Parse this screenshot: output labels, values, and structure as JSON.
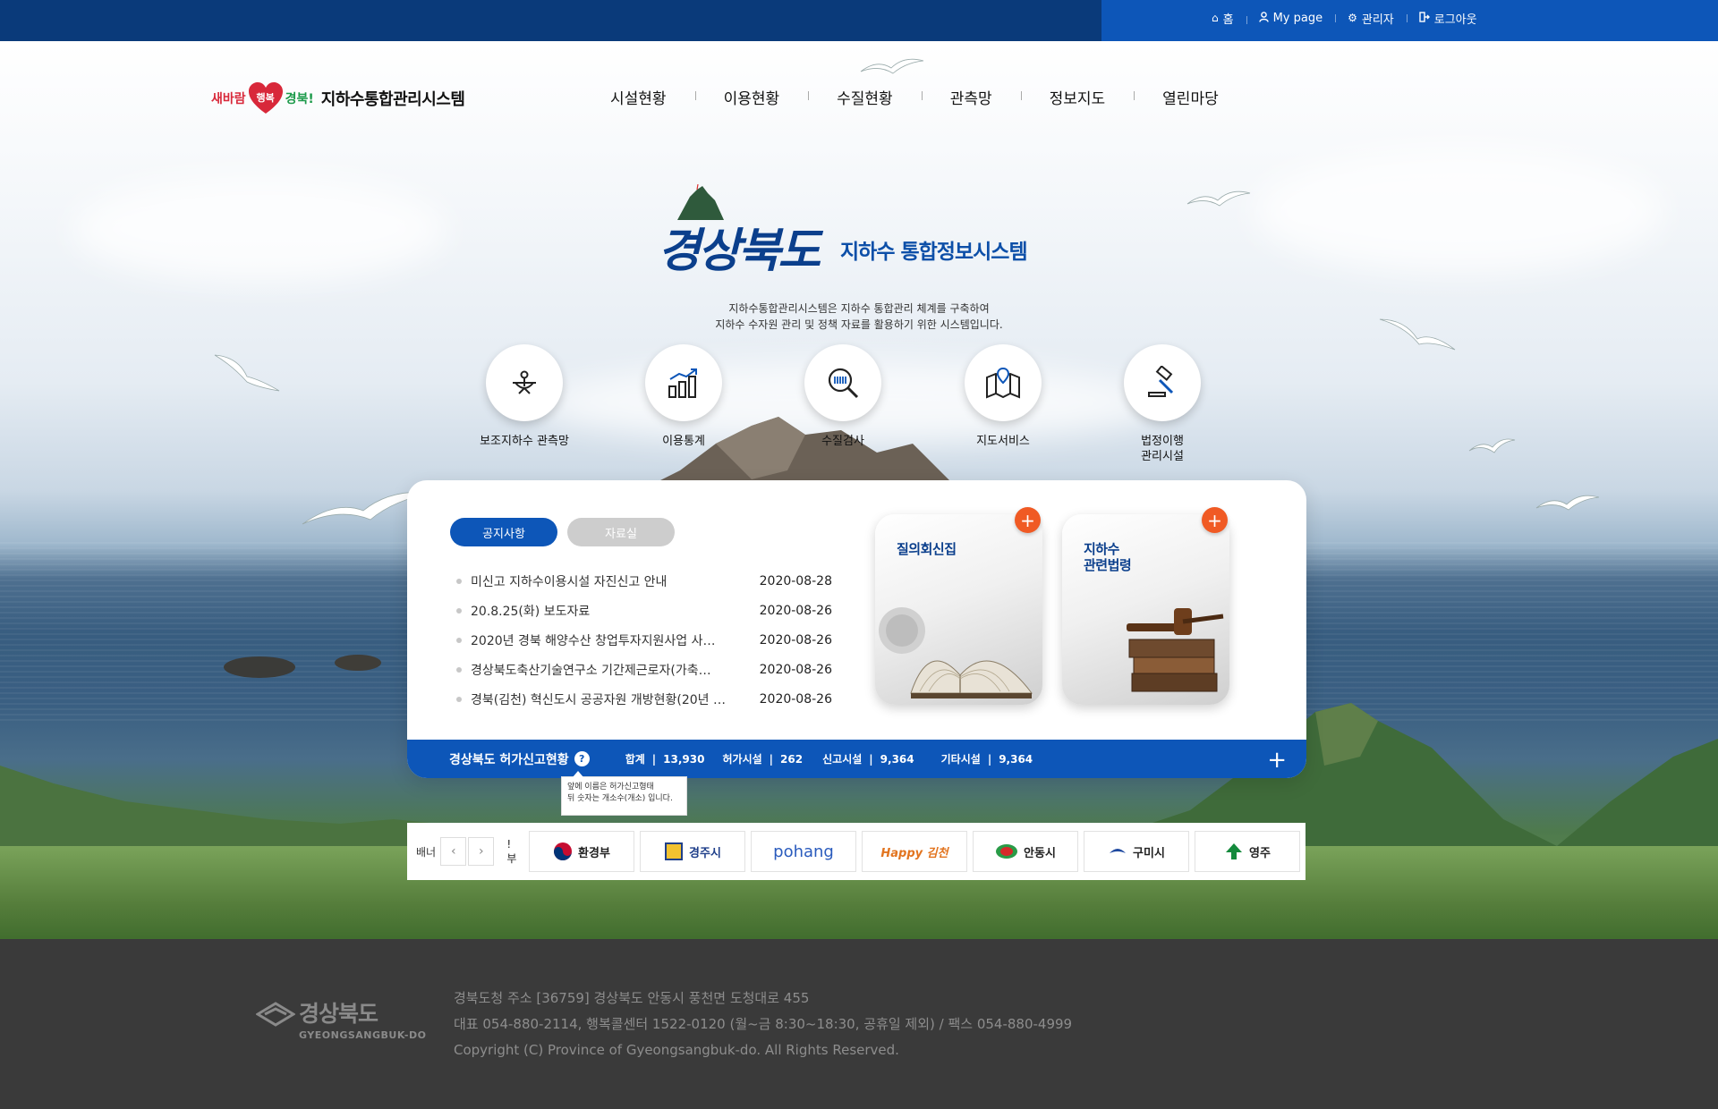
{
  "topbar": {
    "items": [
      {
        "icon": "home-icon",
        "label": "홈"
      },
      {
        "icon": "user-icon",
        "label": "My page"
      },
      {
        "icon": "gear-icon",
        "label": "관리자"
      },
      {
        "icon": "logout-icon",
        "label": "로그아웃"
      }
    ]
  },
  "logo": {
    "slogan_red": "새바람",
    "slogan_heart": "행복",
    "slogan_green": "경북!",
    "title": "지하수통합관리시스템"
  },
  "gnb": [
    "시설현황",
    "이용현황",
    "수질현황",
    "관측망",
    "정보지도",
    "열린마당"
  ],
  "hero": {
    "brand": "경상북도",
    "subtitle": "지하수 통합정보시스템",
    "intro_line1": "지하수통합관리시스템은 지하수 통합관리 체계를 구축하여",
    "intro_line2": "지하수 수자원 관리 및 정책 자료를 활용하기 위한 시스템입니다."
  },
  "quick_links": [
    {
      "icon": "observation-well-icon",
      "label": "보조지하수 관측망"
    },
    {
      "icon": "bar-chart-icon",
      "label": "이용통계"
    },
    {
      "icon": "magnifier-icon",
      "label": "수질검사"
    },
    {
      "icon": "map-pin-icon",
      "label": "지도서비스"
    },
    {
      "icon": "gavel-icon",
      "label": "법정이행\n관리시설"
    }
  ],
  "tabs": {
    "active": "공지사항",
    "inactive": "자료실"
  },
  "notices": [
    {
      "title": "미신고 지하수이용시설 자진신고 안내",
      "date": "2020-08-28"
    },
    {
      "title": "20.8.25(화) 보도자료",
      "date": "2020-08-26"
    },
    {
      "title": "2020년 경북 해양수산 창업투자지원사업 사…",
      "date": "2020-08-26"
    },
    {
      "title": "경상북도축산기술연구소 기간제근로자(가축…",
      "date": "2020-08-26"
    },
    {
      "title": "경북(김천) 혁신도시 공공자원 개방현황(20년 …",
      "date": "2020-08-26"
    }
  ],
  "cards": [
    {
      "title": "질의회신집",
      "plus": "+"
    },
    {
      "title": "지하수\n관련법령",
      "plus": "+"
    }
  ],
  "status": {
    "title": "경상북도 허가신고현황",
    "help": "?",
    "stats": [
      {
        "label": "합계",
        "sep": "|",
        "value": "13,930"
      },
      {
        "label": "허가시설",
        "sep": "|",
        "value": "262"
      },
      {
        "label": "신고시설",
        "sep": "|",
        "value": "9,364"
      },
      {
        "label": "기타시설",
        "sep": "|",
        "value": "9,364"
      }
    ],
    "plus": "+",
    "tooltip_line1": "앞에 이름은 허가신고형태",
    "tooltip_line2": "뒤 숫자는 개소수(개소) 입니다."
  },
  "banner": {
    "label": "배너",
    "prev": "‹",
    "next": "›",
    "cut_text": "!부",
    "logos": [
      "환경부",
      "경주시",
      "pohang",
      "Happy 김천",
      "안동시",
      "구미시",
      "영주"
    ]
  },
  "footer": {
    "logo_ko": "경상북도",
    "logo_en": "GYEONGSANGBUK-DO",
    "line1": "경북도청 주소 [36759] 경상북도 안동시 풍천면 도청대로 455",
    "line2": "대표 054-880-2114, 행복콜센터 1522-0120 (월~금 8:30~18:30, 공휴일 제외) / 팩스 054-880-4999",
    "line3": "Copyright (C) Province of Gyeongsangbuk-do. All Rights Reserved."
  },
  "colors": {
    "primary": "#0d56b8",
    "navy": "#0a3a7a",
    "accent": "#f05a24",
    "footer": "#3a3a3a"
  }
}
